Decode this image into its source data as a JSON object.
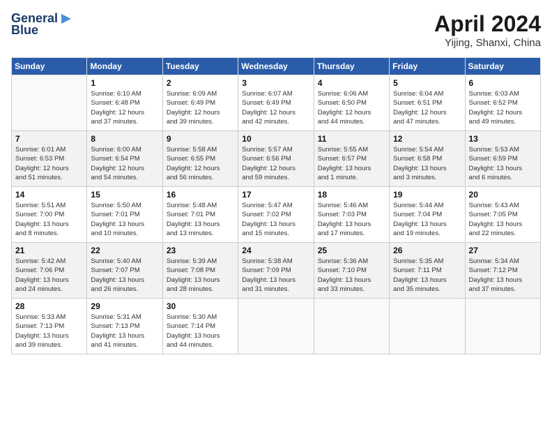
{
  "header": {
    "logo_line1": "General",
    "logo_line2": "Blue",
    "month_year": "April 2024",
    "location": "Yijing, Shanxi, China"
  },
  "weekdays": [
    "Sunday",
    "Monday",
    "Tuesday",
    "Wednesday",
    "Thursday",
    "Friday",
    "Saturday"
  ],
  "weeks": [
    [
      {
        "day": "",
        "info": ""
      },
      {
        "day": "1",
        "info": "Sunrise: 6:10 AM\nSunset: 6:48 PM\nDaylight: 12 hours\nand 37 minutes."
      },
      {
        "day": "2",
        "info": "Sunrise: 6:09 AM\nSunset: 6:49 PM\nDaylight: 12 hours\nand 39 minutes."
      },
      {
        "day": "3",
        "info": "Sunrise: 6:07 AM\nSunset: 6:49 PM\nDaylight: 12 hours\nand 42 minutes."
      },
      {
        "day": "4",
        "info": "Sunrise: 6:06 AM\nSunset: 6:50 PM\nDaylight: 12 hours\nand 44 minutes."
      },
      {
        "day": "5",
        "info": "Sunrise: 6:04 AM\nSunset: 6:51 PM\nDaylight: 12 hours\nand 47 minutes."
      },
      {
        "day": "6",
        "info": "Sunrise: 6:03 AM\nSunset: 6:52 PM\nDaylight: 12 hours\nand 49 minutes."
      }
    ],
    [
      {
        "day": "7",
        "info": "Sunrise: 6:01 AM\nSunset: 6:53 PM\nDaylight: 12 hours\nand 51 minutes."
      },
      {
        "day": "8",
        "info": "Sunrise: 6:00 AM\nSunset: 6:54 PM\nDaylight: 12 hours\nand 54 minutes."
      },
      {
        "day": "9",
        "info": "Sunrise: 5:58 AM\nSunset: 6:55 PM\nDaylight: 12 hours\nand 56 minutes."
      },
      {
        "day": "10",
        "info": "Sunrise: 5:57 AM\nSunset: 6:56 PM\nDaylight: 12 hours\nand 59 minutes."
      },
      {
        "day": "11",
        "info": "Sunrise: 5:55 AM\nSunset: 6:57 PM\nDaylight: 13 hours\nand 1 minute."
      },
      {
        "day": "12",
        "info": "Sunrise: 5:54 AM\nSunset: 6:58 PM\nDaylight: 13 hours\nand 3 minutes."
      },
      {
        "day": "13",
        "info": "Sunrise: 5:53 AM\nSunset: 6:59 PM\nDaylight: 13 hours\nand 6 minutes."
      }
    ],
    [
      {
        "day": "14",
        "info": "Sunrise: 5:51 AM\nSunset: 7:00 PM\nDaylight: 13 hours\nand 8 minutes."
      },
      {
        "day": "15",
        "info": "Sunrise: 5:50 AM\nSunset: 7:01 PM\nDaylight: 13 hours\nand 10 minutes."
      },
      {
        "day": "16",
        "info": "Sunrise: 5:48 AM\nSunset: 7:01 PM\nDaylight: 13 hours\nand 13 minutes."
      },
      {
        "day": "17",
        "info": "Sunrise: 5:47 AM\nSunset: 7:02 PM\nDaylight: 13 hours\nand 15 minutes."
      },
      {
        "day": "18",
        "info": "Sunrise: 5:46 AM\nSunset: 7:03 PM\nDaylight: 13 hours\nand 17 minutes."
      },
      {
        "day": "19",
        "info": "Sunrise: 5:44 AM\nSunset: 7:04 PM\nDaylight: 13 hours\nand 19 minutes."
      },
      {
        "day": "20",
        "info": "Sunrise: 5:43 AM\nSunset: 7:05 PM\nDaylight: 13 hours\nand 22 minutes."
      }
    ],
    [
      {
        "day": "21",
        "info": "Sunrise: 5:42 AM\nSunset: 7:06 PM\nDaylight: 13 hours\nand 24 minutes."
      },
      {
        "day": "22",
        "info": "Sunrise: 5:40 AM\nSunset: 7:07 PM\nDaylight: 13 hours\nand 26 minutes."
      },
      {
        "day": "23",
        "info": "Sunrise: 5:39 AM\nSunset: 7:08 PM\nDaylight: 13 hours\nand 28 minutes."
      },
      {
        "day": "24",
        "info": "Sunrise: 5:38 AM\nSunset: 7:09 PM\nDaylight: 13 hours\nand 31 minutes."
      },
      {
        "day": "25",
        "info": "Sunrise: 5:36 AM\nSunset: 7:10 PM\nDaylight: 13 hours\nand 33 minutes."
      },
      {
        "day": "26",
        "info": "Sunrise: 5:35 AM\nSunset: 7:11 PM\nDaylight: 13 hours\nand 35 minutes."
      },
      {
        "day": "27",
        "info": "Sunrise: 5:34 AM\nSunset: 7:12 PM\nDaylight: 13 hours\nand 37 minutes."
      }
    ],
    [
      {
        "day": "28",
        "info": "Sunrise: 5:33 AM\nSunset: 7:13 PM\nDaylight: 13 hours\nand 39 minutes."
      },
      {
        "day": "29",
        "info": "Sunrise: 5:31 AM\nSunset: 7:13 PM\nDaylight: 13 hours\nand 41 minutes."
      },
      {
        "day": "30",
        "info": "Sunrise: 5:30 AM\nSunset: 7:14 PM\nDaylight: 13 hours\nand 44 minutes."
      },
      {
        "day": "",
        "info": ""
      },
      {
        "day": "",
        "info": ""
      },
      {
        "day": "",
        "info": ""
      },
      {
        "day": "",
        "info": ""
      }
    ]
  ]
}
